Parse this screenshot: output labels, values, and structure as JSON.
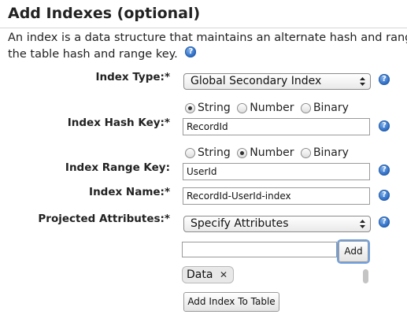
{
  "section": {
    "title": "Add Indexes (optional)",
    "description_line1": "An index is a data structure that maintains an alternate hash and range",
    "description_line2": "the table hash and range key."
  },
  "form": {
    "index_type": {
      "label": "Index Type:*",
      "value": "Global Secondary Index"
    },
    "hash_key": {
      "types": [
        "String",
        "Number",
        "Binary"
      ],
      "selected": "String",
      "label": "Index Hash Key:*",
      "value": "RecordId"
    },
    "range_key": {
      "types": [
        "String",
        "Number",
        "Binary"
      ],
      "selected": "Number",
      "label": "Index Range Key:",
      "value": "UserId"
    },
    "index_name": {
      "label": "Index Name:*",
      "value": "RecordId-UserId-index"
    },
    "projected": {
      "label": "Projected Attributes:*",
      "value": "Specify Attributes"
    },
    "attribute_input": {
      "value": ""
    },
    "add_label": "Add",
    "attributes": [
      "Data"
    ],
    "remove_glyph": "✕",
    "submit_label": "Add Index To Table"
  },
  "colors": {
    "help_icon": "#2f6fc8",
    "focus_ring": "#6ea0e0"
  },
  "icons": {
    "help": "question-icon",
    "select": "select-arrows-icon",
    "remove": "close-icon"
  }
}
